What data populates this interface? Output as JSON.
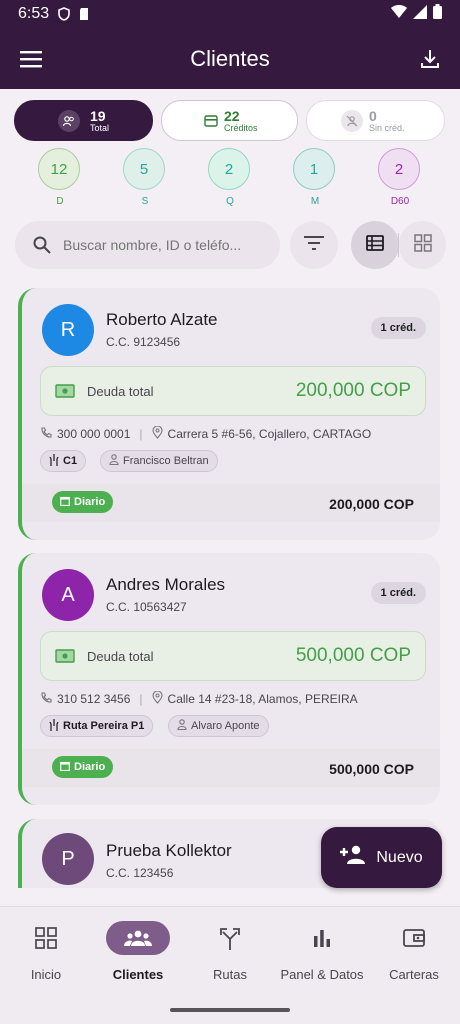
{
  "status_bar": {
    "time": "6:53"
  },
  "app_bar": {
    "title": "Clientes"
  },
  "summary_tabs": [
    {
      "count": "19",
      "label": "Total",
      "active": true
    },
    {
      "count": "22",
      "label": "Créditos",
      "active": false
    },
    {
      "count": "0",
      "label": "Sin créd.",
      "active": false
    }
  ],
  "frequency_filters": [
    {
      "count": "12",
      "label": "D",
      "color": "#43a047"
    },
    {
      "count": "5",
      "label": "S",
      "color": "#26a69a"
    },
    {
      "count": "2",
      "label": "Q",
      "color": "#26a69a"
    },
    {
      "count": "1",
      "label": "M",
      "color": "#26a69a"
    },
    {
      "count": "2",
      "label": "D60",
      "color": "#9c27b0"
    }
  ],
  "search": {
    "placeholder": "Buscar nombre, ID o teléfo..."
  },
  "clients": [
    {
      "initial": "R",
      "avatar_color": "#1e88e5",
      "name": "Roberto Alzate",
      "id": "C.C. 9123456",
      "credits": "1 créd.",
      "debt_label": "Deuda total",
      "debt": "200,000 COP",
      "phone": "300 000 0001",
      "address": "Carrera 5 #6-56, Cojallero, CARTAGO",
      "route": "C1",
      "collector": "Francisco Beltran",
      "frequency": "Diario",
      "amount": "200,000 COP"
    },
    {
      "initial": "A",
      "avatar_color": "#8e24aa",
      "name": "Andres Morales",
      "id": "C.C. 10563427",
      "credits": "1 créd.",
      "debt_label": "Deuda total",
      "debt": "500,000 COP",
      "phone": "310 512 3456",
      "address": "Calle 14 #23-18, Alamos, PEREIRA",
      "route": "Ruta Pereira P1",
      "collector": "Alvaro Aponte",
      "frequency": "Diario",
      "amount": "500,000 COP"
    },
    {
      "initial": "P",
      "avatar_color": "#6d4a7a",
      "name": "Prueba Kollektor",
      "id": "C.C. 123456"
    }
  ],
  "fab": {
    "label": "Nuevo"
  },
  "bottom_nav": [
    {
      "label": "Inicio",
      "icon": "grid-icon",
      "active": false
    },
    {
      "label": "Clientes",
      "icon": "people-icon",
      "active": true
    },
    {
      "label": "Rutas",
      "icon": "route-icon",
      "active": false
    },
    {
      "label": "Panel & Datos",
      "icon": "bar-chart-icon",
      "active": false
    },
    {
      "label": "Carteras",
      "icon": "wallet-icon",
      "active": false
    }
  ],
  "colors": {
    "primary": "#35193f",
    "accent_green": "#43a047",
    "active_nav": "#7f5d8a"
  }
}
